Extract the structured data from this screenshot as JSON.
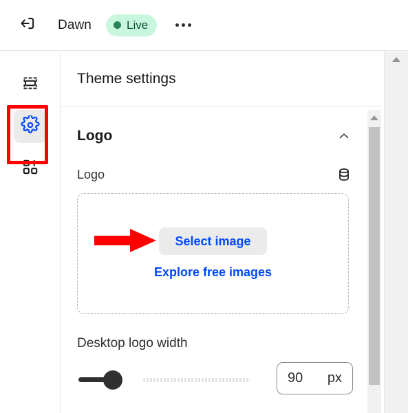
{
  "topbar": {
    "exit_icon": "exit-icon",
    "theme_name": "Dawn",
    "status_badge": {
      "label": "Live",
      "bg_color": "#c9f7dd",
      "text_color": "#0c5132",
      "dot_color": "#29845a"
    },
    "more_icon": "more-horizontal-icon"
  },
  "rail": {
    "items": [
      {
        "name": "sections-icon",
        "label": "Sections",
        "selected": false
      },
      {
        "name": "gear-icon",
        "label": "Theme settings",
        "selected": true
      },
      {
        "name": "apps-icon",
        "label": "Apps",
        "selected": false
      }
    ]
  },
  "panel": {
    "title": "Theme settings",
    "section": {
      "title": "Logo",
      "collapse_icon": "chevron-up-icon"
    },
    "logo_field": {
      "label": "Logo",
      "meta_icon": "database-icon",
      "select_button": "Select image",
      "explore_link": "Explore free images"
    },
    "width_field": {
      "label": "Desktop logo width",
      "value": "90",
      "unit": "px"
    }
  },
  "annotations": {
    "arrow_color": "#ff0000",
    "box_color": "#ff0000",
    "arrow_target": "Select image",
    "box_target": "Theme settings rail button"
  },
  "scrollbars": {
    "outer": {
      "arrow_icon": "scroll-up-arrow-icon"
    },
    "inner": {
      "arrow_icon": "scroll-up-arrow-icon"
    }
  },
  "colors": {
    "accent_link": "#0049ff",
    "text_primary": "#1a1a1a",
    "text_secondary": "#303030",
    "selected_bg": "#ebebeb",
    "border": "#e6e6e6"
  }
}
